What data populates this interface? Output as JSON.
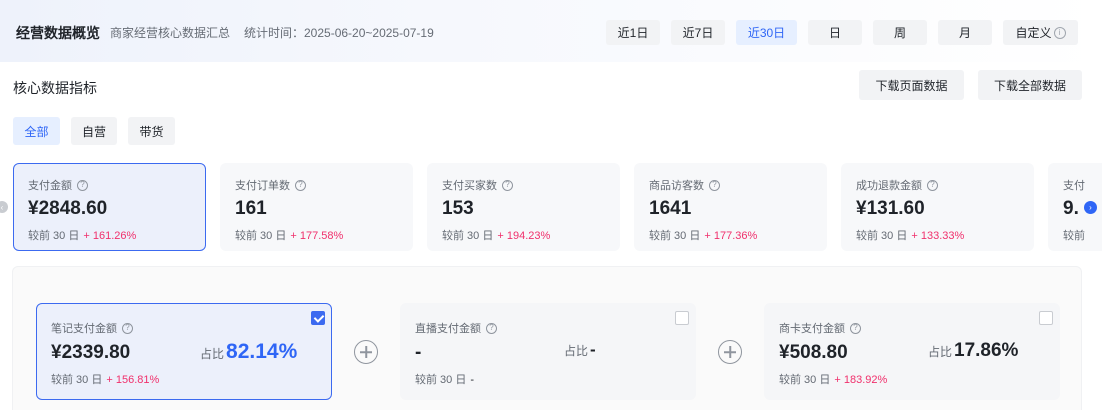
{
  "header": {
    "title": "经营数据概览",
    "subtitle": "商家经营核心数据汇总",
    "stat_time": "统计时间：2025-06-20~2025-07-19",
    "ranges": [
      {
        "label": "近1日",
        "active": false
      },
      {
        "label": "近7日",
        "active": false
      },
      {
        "label": "近30日",
        "active": true
      },
      {
        "label": "日",
        "active": false
      },
      {
        "label": "周",
        "active": false
      },
      {
        "label": "月",
        "active": false
      },
      {
        "label": "自定义",
        "active": false
      }
    ]
  },
  "section": {
    "title": "核心数据指标",
    "download_page": "下载页面数据",
    "download_all": "下载全部数据"
  },
  "filters": [
    {
      "label": "全部",
      "active": true
    },
    {
      "label": "自营",
      "active": false
    },
    {
      "label": "带货",
      "active": false
    }
  ],
  "metrics": [
    {
      "label": "支付金额",
      "value": "¥2848.60",
      "cmp_label": "较前 30 日",
      "change": "+ 161.26%",
      "selected": true
    },
    {
      "label": "支付订单数",
      "value": "161",
      "cmp_label": "较前 30 日",
      "change": "+ 177.58%",
      "selected": false
    },
    {
      "label": "支付买家数",
      "value": "153",
      "cmp_label": "较前 30 日",
      "change": "+ 194.23%",
      "selected": false
    },
    {
      "label": "商品访客数",
      "value": "1641",
      "cmp_label": "较前 30 日",
      "change": "+ 177.36%",
      "selected": false
    },
    {
      "label": "成功退款金额",
      "value": "¥131.60",
      "cmp_label": "较前 30 日",
      "change": "+ 133.33%",
      "selected": false
    },
    {
      "label": "支付",
      "value": "9.",
      "cmp_label": "较前",
      "change": "",
      "selected": false
    }
  ],
  "breakdown": [
    {
      "label": "笔记支付金额",
      "value": "¥2339.80",
      "share_label": "占比",
      "share": "82.14%",
      "cmp_label": "较前 30 日",
      "change": "+ 156.81%",
      "checked": true
    },
    {
      "label": "直播支付金额",
      "value": "-",
      "share_label": "占比",
      "share": "-",
      "cmp_label": "较前 30 日",
      "change": "-",
      "checked": false
    },
    {
      "label": "商卡支付金额",
      "value": "¥508.80",
      "share_label": "占比",
      "share": "17.86%",
      "cmp_label": "较前 30 日",
      "change": "+ 183.92%",
      "checked": false
    }
  ],
  "icons": {
    "help": "question-circle-icon",
    "info": "info-icon",
    "plus": "plus-circle-icon",
    "scroll_left": "chevron-left-icon",
    "scroll_right": "chevron-right-icon"
  },
  "colors": {
    "accent": "#2f66f6",
    "positive_change": "#f0306c",
    "selected_bg": "#ecf0fb"
  }
}
